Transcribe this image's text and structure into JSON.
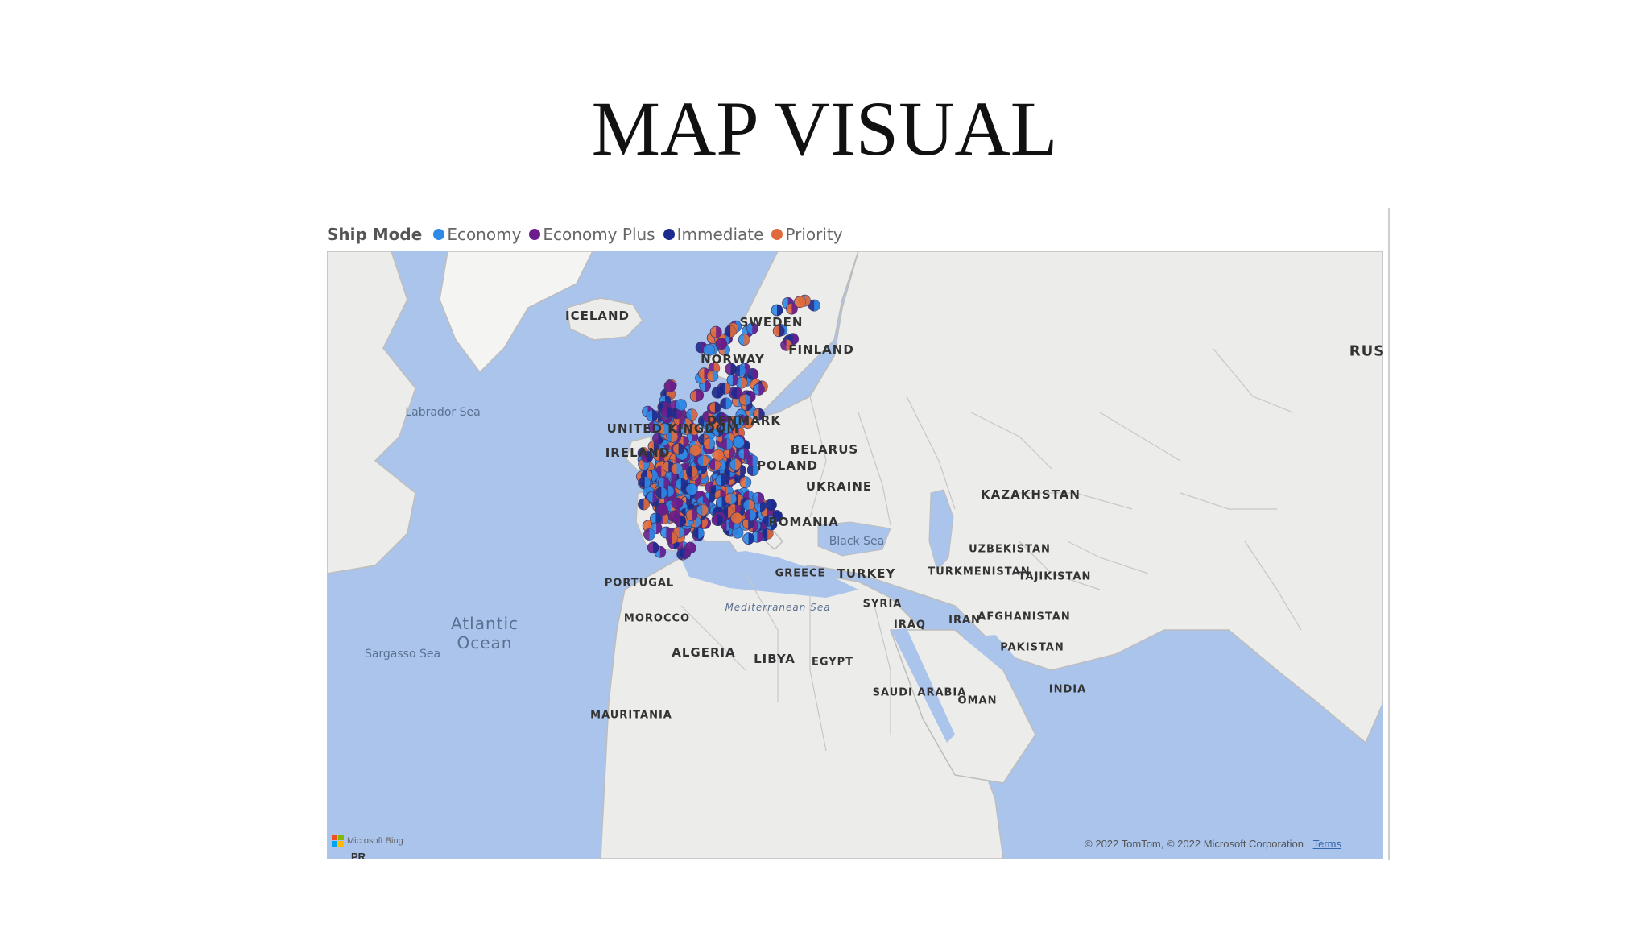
{
  "slide": {
    "title": "MAP VISUAL"
  },
  "legend": {
    "title": "Ship Mode",
    "items": [
      {
        "label": "Economy",
        "color": "#2f8ae6"
      },
      {
        "label": "Economy Plus",
        "color": "#6b1d8c"
      },
      {
        "label": "Immediate",
        "color": "#1c2a8f"
      },
      {
        "label": "Priority",
        "color": "#e06a3b"
      }
    ]
  },
  "map": {
    "provider": "Microsoft Bing",
    "attribution": "© 2022 TomTom, © 2022 Microsoft Corporation",
    "terms": "Terms",
    "partial_label": "PR",
    "country_labels": [
      "ICELAND",
      "SWEDEN",
      "FINLAND",
      "NORWAY",
      "RUS",
      "DENMARK",
      "UNITED KINGDOM",
      "IRELAND",
      "BELARUS",
      "POLAND",
      "UKRAINE",
      "KAZAKHSTAN",
      "ROMANIA",
      "UZBEKISTAN",
      "TURKMENISTAN",
      "TAJIKISTAN",
      "GREECE",
      "TURKEY",
      "PORTUGAL",
      "SYRIA",
      "IRAQ",
      "IRAN",
      "AFGHANISTAN",
      "MOROCCO",
      "PAKISTAN",
      "ALGERIA",
      "LIBYA",
      "EGYPT",
      "SAUDI ARABIA",
      "OMAN",
      "INDIA",
      "MAURITANIA"
    ],
    "water_labels": [
      "Labrador Sea",
      "Black Sea",
      "Mediterranean Sea",
      "Sargasso Sea"
    ],
    "ocean_label": "Atlantic\nOcean"
  }
}
